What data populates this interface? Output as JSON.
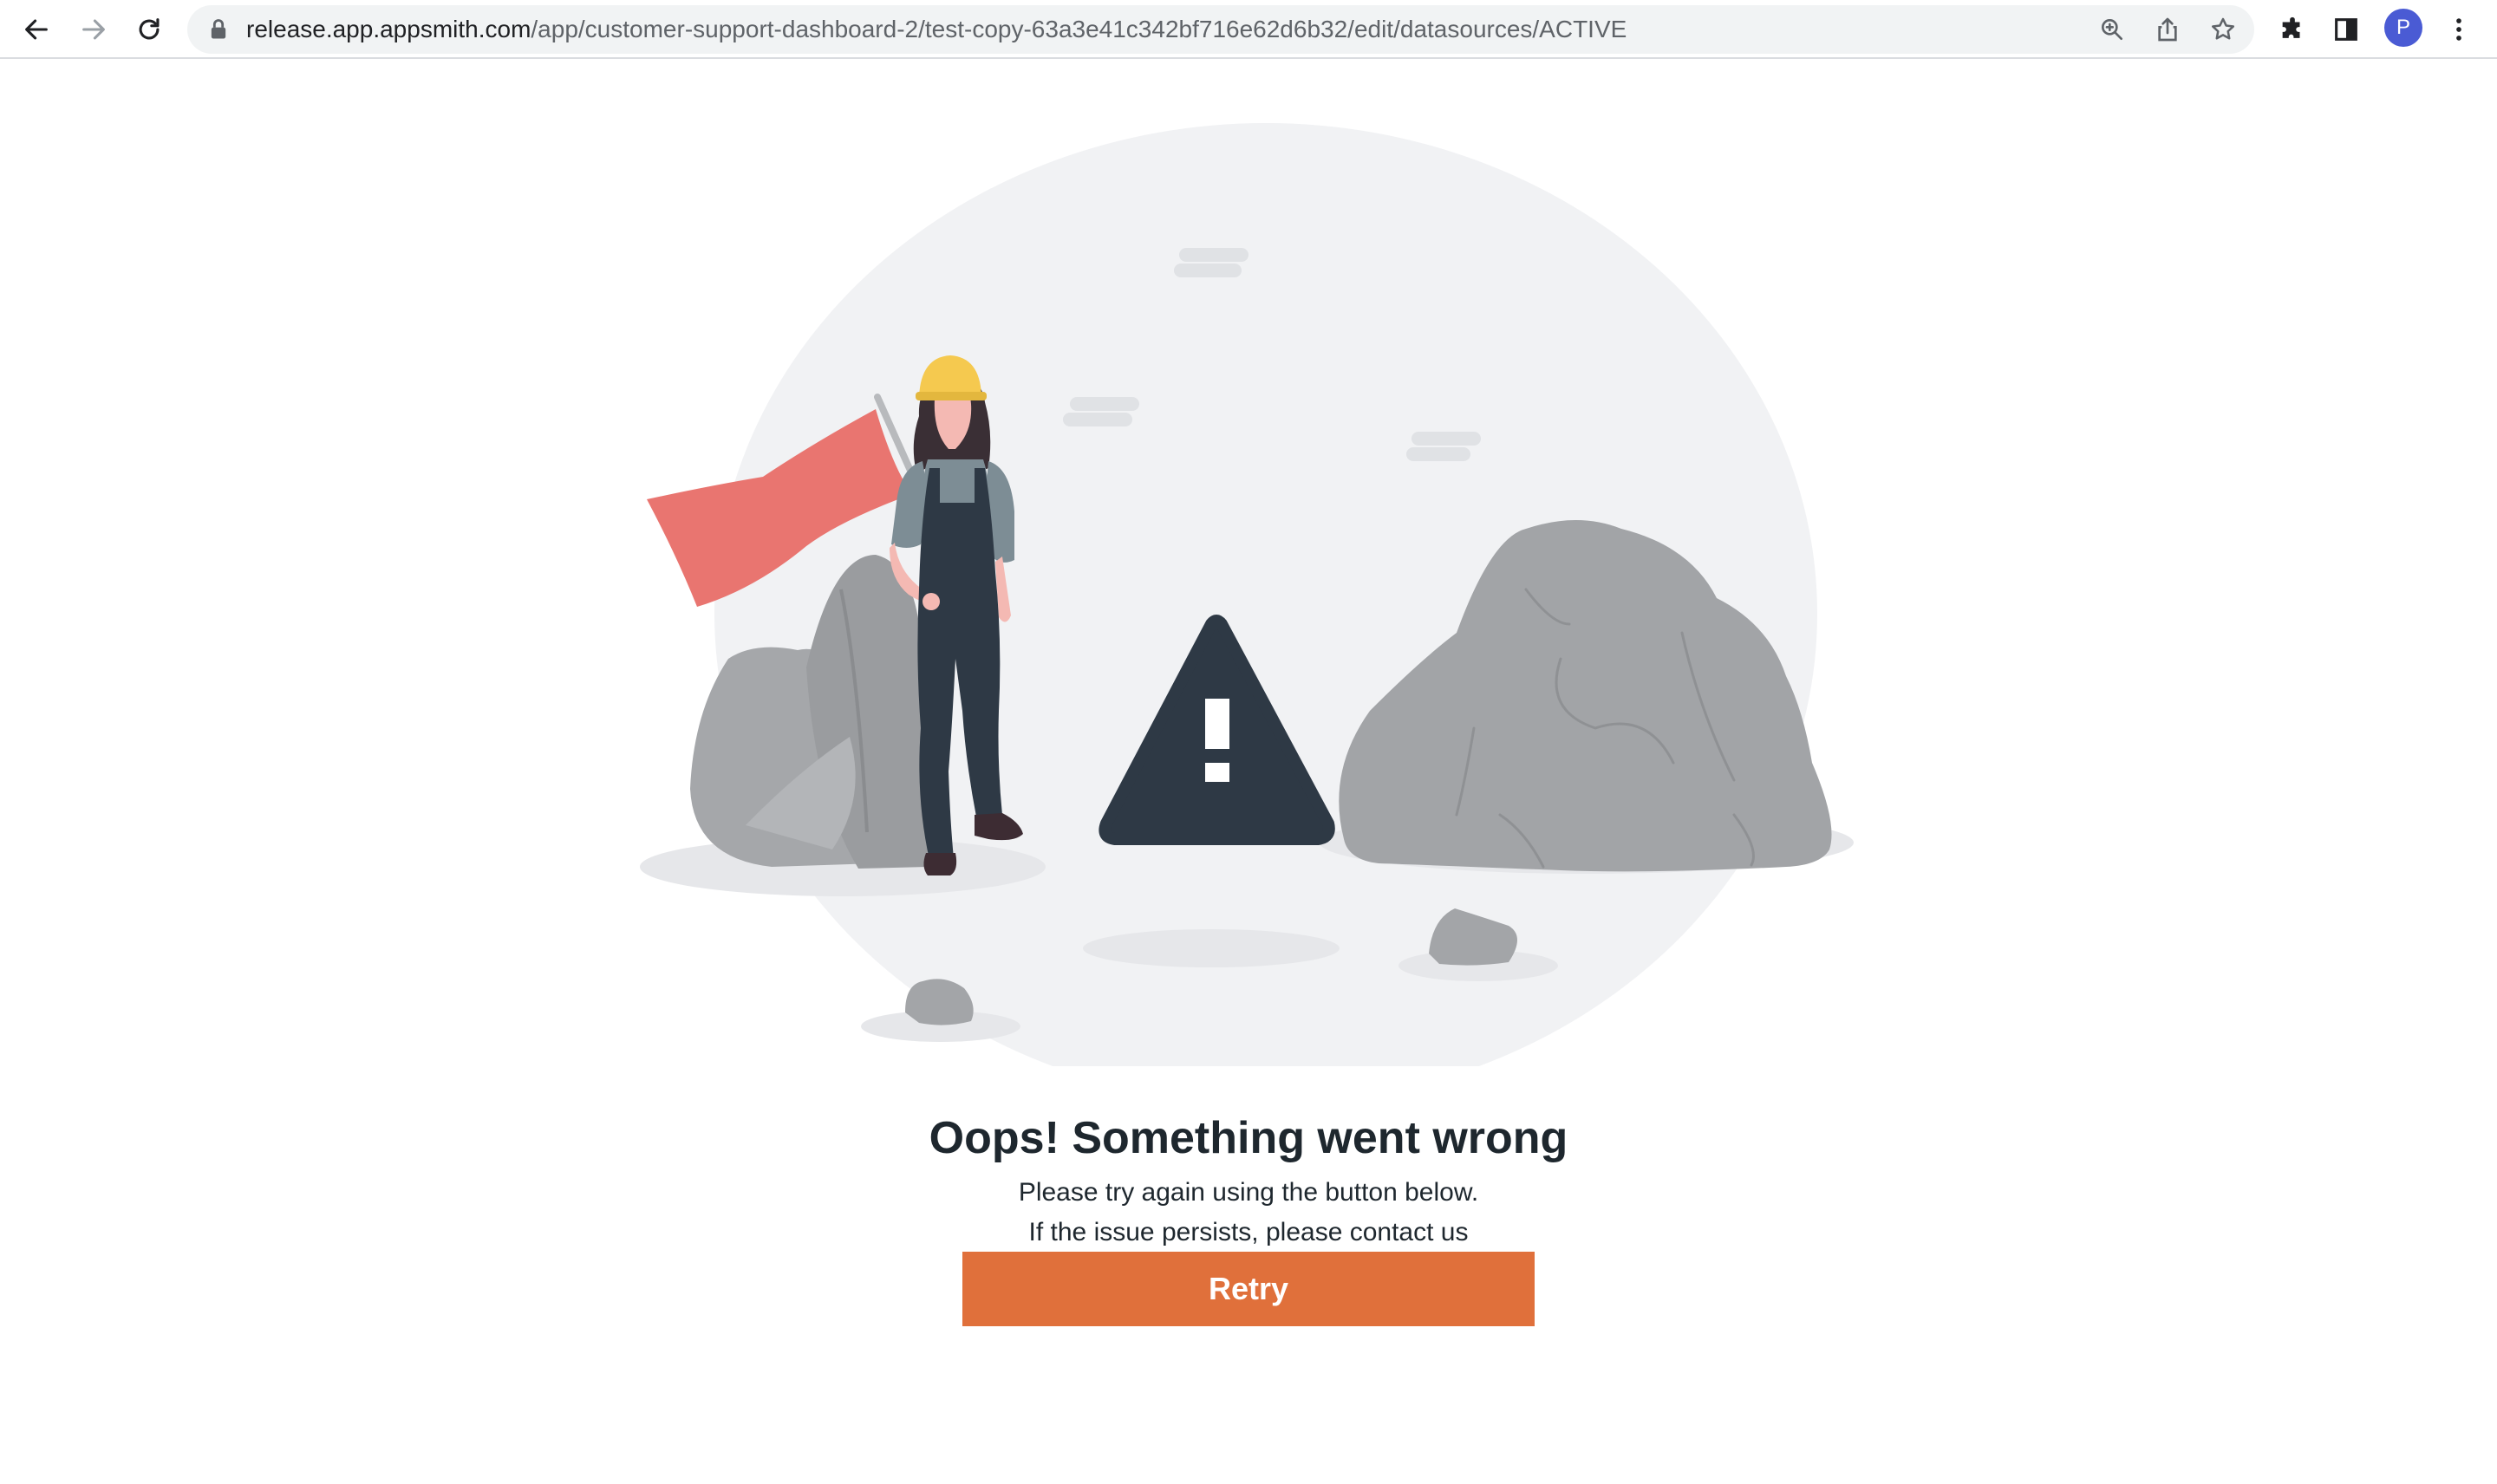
{
  "browser": {
    "url_host": "release.app.appsmith.com",
    "url_path": "/app/customer-support-dashboard-2/test-copy-63a3e41c342bf716e62d6b32/edit/datasources/ACTIVE",
    "profile_initial": "P",
    "icons": {
      "back": "arrow-left-icon",
      "forward": "arrow-right-icon",
      "reload": "reload-icon",
      "lock": "lock-icon",
      "zoom": "zoom-icon",
      "share": "share-icon",
      "bookmark": "star-icon",
      "extensions": "puzzle-icon",
      "side_panel": "side-panel-icon",
      "menu": "kebab-menu-icon"
    }
  },
  "error_page": {
    "title": "Oops! Something went wrong",
    "line1": "Please try again using the button below.",
    "line2": "If the issue persists, please contact us",
    "retry_label": "Retry"
  },
  "colors": {
    "accent": "#e0703b",
    "text": "#1e272e",
    "flag": "#e97570",
    "rock": "#9fa2a5",
    "hardhat": "#f5c94f",
    "warning": "#2e3945",
    "backdrop": "#f1f2f4"
  }
}
